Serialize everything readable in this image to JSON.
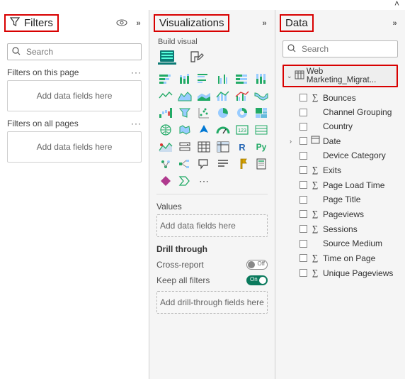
{
  "top": {
    "collapse_glyph": "˄"
  },
  "filters": {
    "title": "Filters",
    "search_placeholder": "Search",
    "sections": {
      "page": {
        "title": "Filters on this page",
        "drop": "Add data fields here"
      },
      "all": {
        "title": "Filters on all pages",
        "drop": "Add data fields here"
      }
    }
  },
  "viz": {
    "title": "Visualizations",
    "build_label": "Build visual",
    "values_title": "Values",
    "values_drop": "Add data fields here",
    "drill_title": "Drill through",
    "cross_label": "Cross-report",
    "cross_state": "Off",
    "keep_label": "Keep all filters",
    "keep_state": "On",
    "drill_drop": "Add drill-through fields here"
  },
  "data": {
    "title": "Data",
    "search_placeholder": "Search",
    "table_name": "Web Marketing_Migrat...",
    "fields": [
      {
        "name": "Bounces",
        "sigma": true,
        "expandable": false
      },
      {
        "name": "Channel Grouping",
        "sigma": false,
        "expandable": false
      },
      {
        "name": "Country",
        "sigma": false,
        "expandable": false
      },
      {
        "name": "Date",
        "sigma": false,
        "expandable": true,
        "icon": "table"
      },
      {
        "name": "Device Category",
        "sigma": false,
        "expandable": false
      },
      {
        "name": "Exits",
        "sigma": true,
        "expandable": false
      },
      {
        "name": "Page Load Time",
        "sigma": true,
        "expandable": false
      },
      {
        "name": "Page Title",
        "sigma": false,
        "expandable": false
      },
      {
        "name": "Pageviews",
        "sigma": true,
        "expandable": false
      },
      {
        "name": "Sessions",
        "sigma": true,
        "expandable": false
      },
      {
        "name": "Source Medium",
        "sigma": false,
        "expandable": false
      },
      {
        "name": "Time on Page",
        "sigma": true,
        "expandable": false
      },
      {
        "name": "Unique Pageviews",
        "sigma": true,
        "expandable": false
      }
    ]
  }
}
